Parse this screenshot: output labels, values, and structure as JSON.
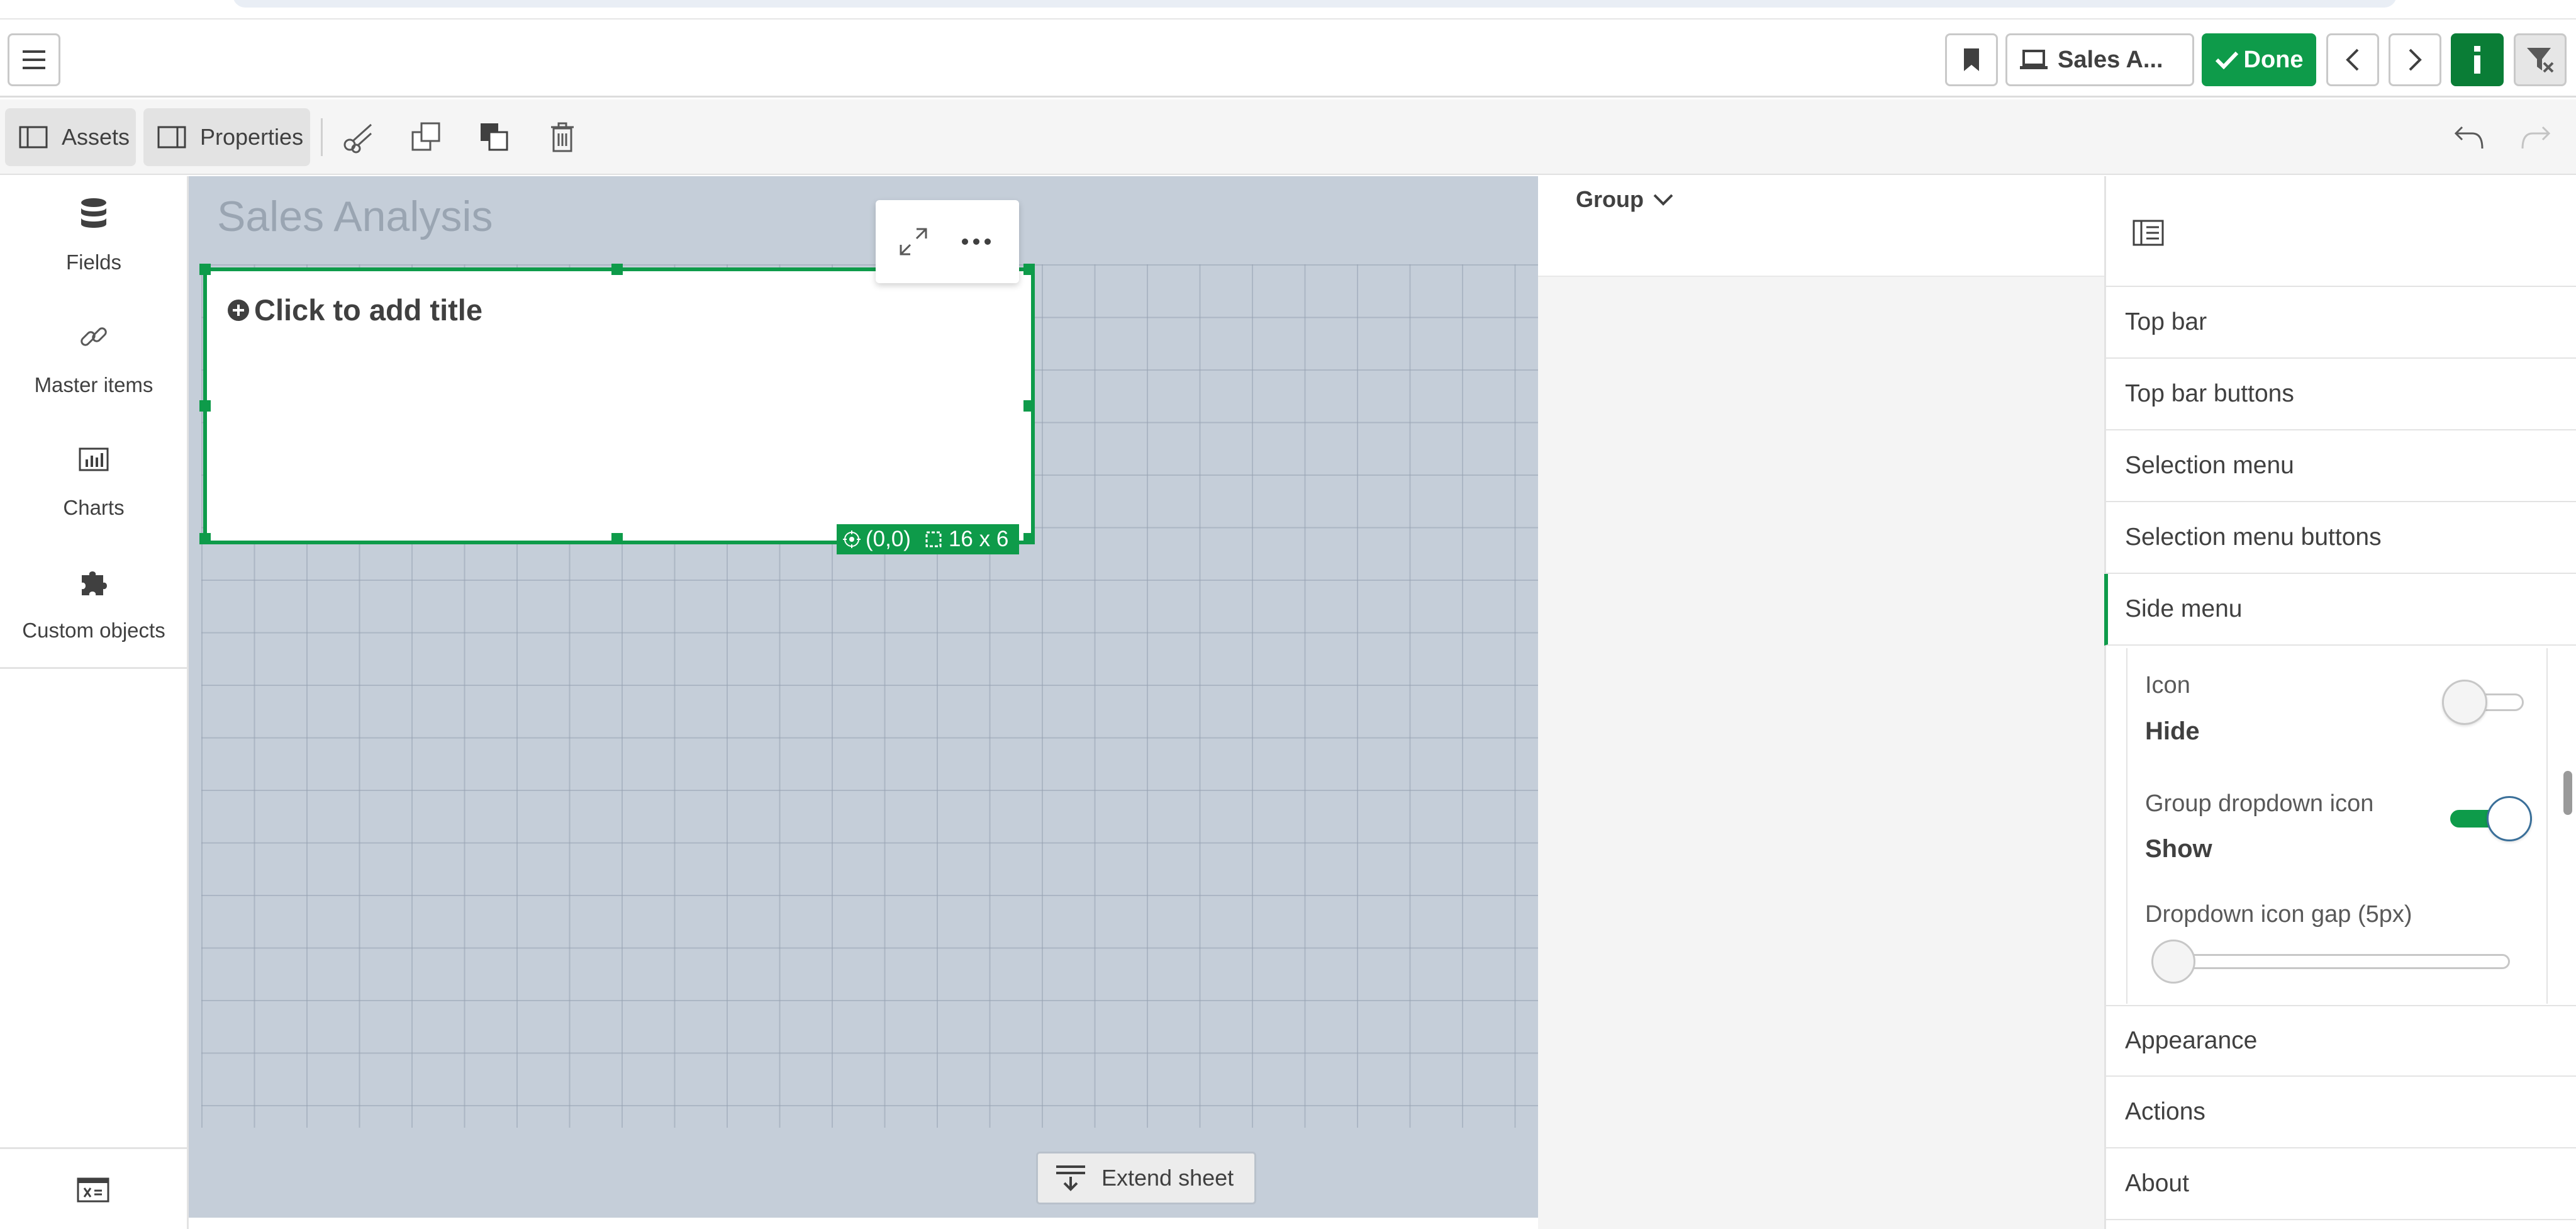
{
  "header": {
    "app_button_label": "Sales A...",
    "done_label": "Done"
  },
  "toolbar": {
    "assets_label": "Assets",
    "properties_label": "Properties"
  },
  "assets_panel": {
    "items": [
      {
        "label": "Fields",
        "icon": "database-icon"
      },
      {
        "label": "Master items",
        "icon": "link-icon"
      },
      {
        "label": "Charts",
        "icon": "bar-chart-icon"
      },
      {
        "label": "Custom objects",
        "icon": "puzzle-icon"
      }
    ]
  },
  "sheet": {
    "title": "Sales Analysis",
    "object": {
      "add_title_text": "Click to add title",
      "position_text": "(0,0)",
      "size_text": "16 x 6"
    },
    "extend_label": "Extend sheet"
  },
  "preview": {
    "group_label": "Group"
  },
  "properties_panel": {
    "sections": [
      {
        "label": "Top bar"
      },
      {
        "label": "Top bar buttons"
      },
      {
        "label": "Selection menu"
      },
      {
        "label": "Selection menu buttons"
      },
      {
        "label": "Side menu"
      },
      {
        "label": "Appearance"
      },
      {
        "label": "Actions"
      },
      {
        "label": "About"
      }
    ],
    "side_menu": {
      "icon_label": "Icon",
      "icon_value": "Hide",
      "icon_toggle_on": false,
      "group_dropdown_label": "Group dropdown icon",
      "group_dropdown_value": "Show",
      "group_dropdown_toggle_on": true,
      "gap_label": "Dropdown icon gap (5px)",
      "gap_slider_fraction": 0
    }
  },
  "colors": {
    "accent_green": "#0e9b4a",
    "info_green": "#0a7d36",
    "canvas_bg": "#c5ced9"
  }
}
